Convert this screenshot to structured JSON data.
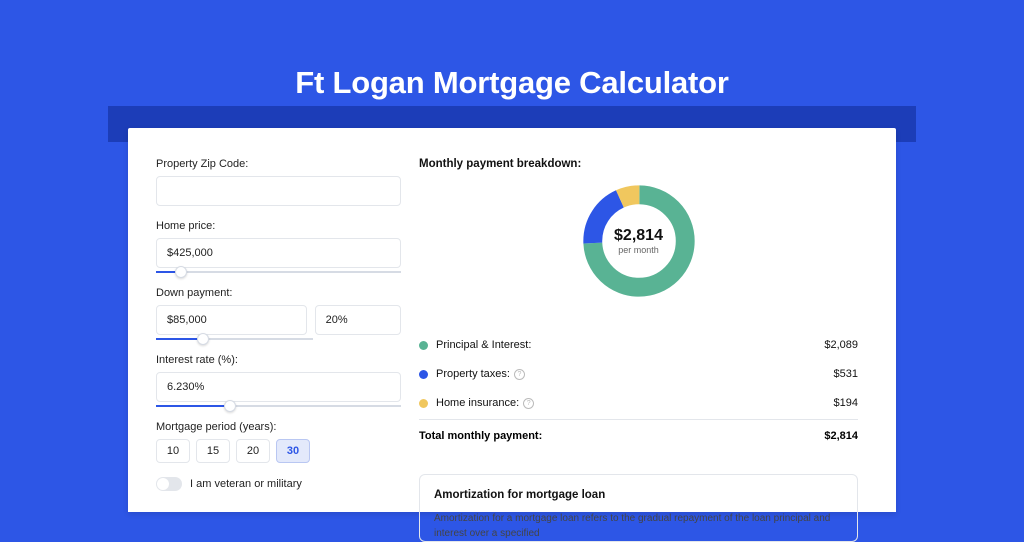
{
  "title": "Ft Logan Mortgage Calculator",
  "form": {
    "zip_label": "Property Zip Code:",
    "zip_value": "",
    "home_price_label": "Home price:",
    "home_price_value": "$425,000",
    "home_price_slider_pct": 10,
    "down_payment_label": "Down payment:",
    "down_payment_value": "$85,000",
    "down_payment_pct": "20%",
    "down_payment_slider_pct": 20,
    "interest_label": "Interest rate (%):",
    "interest_value": "6.230%",
    "interest_slider_pct": 30,
    "period_label": "Mortgage period (years):",
    "periods": [
      "10",
      "15",
      "20",
      "30"
    ],
    "period_active": "30",
    "veteran_label": "I am veteran or military"
  },
  "breakdown": {
    "title": "Monthly payment breakdown:",
    "center_value": "$2,814",
    "center_sub": "per month",
    "items": [
      {
        "label": "Principal & Interest:",
        "value": "$2,089",
        "color": "g",
        "help": false
      },
      {
        "label": "Property taxes:",
        "value": "$531",
        "color": "b",
        "help": true
      },
      {
        "label": "Home insurance:",
        "value": "$194",
        "color": "y",
        "help": true
      }
    ],
    "total_label": "Total monthly payment:",
    "total_value": "$2,814"
  },
  "amort": {
    "title": "Amortization for mortgage loan",
    "text": "Amortization for a mortgage loan refers to the gradual repayment of the loan principal and interest over a specified"
  },
  "chart_data": {
    "type": "pie",
    "title": "Monthly payment breakdown",
    "series": [
      {
        "name": "Principal & Interest",
        "value": 2089,
        "color": "#59b394"
      },
      {
        "name": "Property taxes",
        "value": 531,
        "color": "#2d56e6"
      },
      {
        "name": "Home insurance",
        "value": 194,
        "color": "#f0c75e"
      }
    ],
    "total": 2814
  }
}
